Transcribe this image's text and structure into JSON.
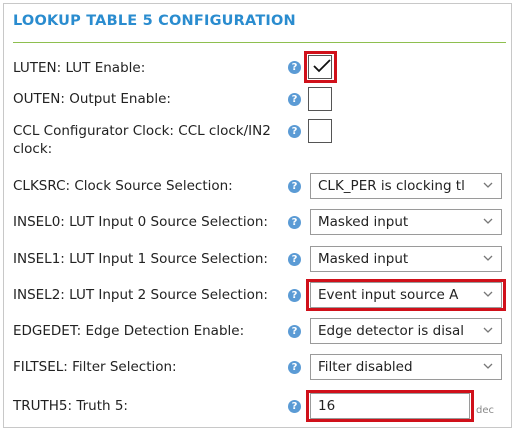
{
  "panel": {
    "title": "LOOKUP TABLE 5 CONFIGURATION",
    "help_glyph": "?"
  },
  "fields": {
    "luten": {
      "label": "LUTEN: LUT Enable:",
      "checked": true
    },
    "outen": {
      "label": "OUTEN: Output Enable:",
      "checked": false
    },
    "ccl_clock": {
      "label": "CCL Configurator Clock: CCL clock/IN2 clock:",
      "checked": false
    },
    "clksrc": {
      "label": "CLKSRC: Clock Source Selection:",
      "value": "CLK_PER is clocking tl"
    },
    "insel0": {
      "label": "INSEL0: LUT Input 0 Source Selection:",
      "value": "Masked input"
    },
    "insel1": {
      "label": "INSEL1: LUT Input 1 Source Selection:",
      "value": "Masked input"
    },
    "insel2": {
      "label": "INSEL2: LUT Input 2 Source Selection:",
      "value": "Event input source A"
    },
    "edgedet": {
      "label": "EDGEDET: Edge Detection Enable:",
      "value": "Edge detector is disal"
    },
    "filtsel": {
      "label": "FILTSEL: Filter Selection:",
      "value": "Filter disabled"
    },
    "truth5": {
      "label": "TRUTH5: Truth 5:",
      "value": "16",
      "unit": "dec"
    }
  },
  "colors": {
    "title": "#2a8ccf",
    "title_rule": "#8ebf4f",
    "help_icon": "#5b9bd5",
    "highlight": "#d0101a"
  },
  "icons": {
    "help": "help-icon",
    "check": "checkmark-icon",
    "dropdown": "chevron-down-icon"
  }
}
